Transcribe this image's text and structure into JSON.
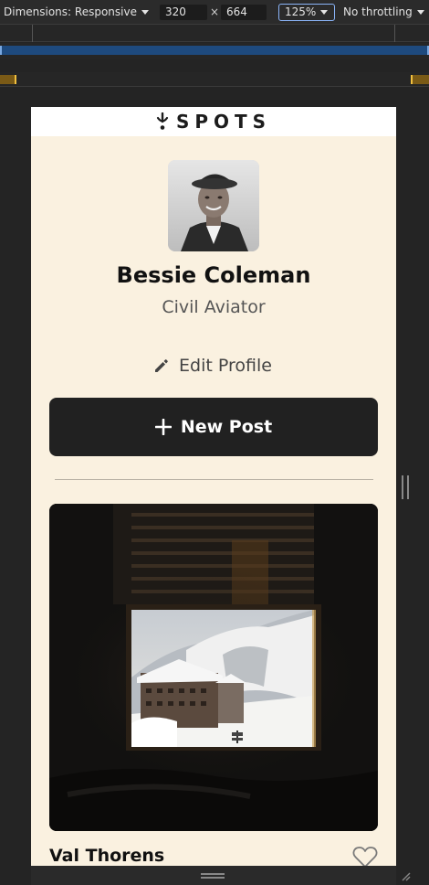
{
  "devtools": {
    "dimensions_label": "Dimensions: Responsive",
    "width_value": "320",
    "times": "×",
    "height_value": "664",
    "zoom": "125%",
    "throttling": "No throttling"
  },
  "app": {
    "logo_text": "SPOTS"
  },
  "profile": {
    "name": "Bessie Coleman",
    "description": "Civil Aviator",
    "edit_label": "Edit Profile",
    "new_post_label": "New Post"
  },
  "cards": [
    {
      "title": "Val Thorens",
      "liked": false
    }
  ],
  "colors": {
    "page_background": "#faf1e0",
    "button_dark": "#212121",
    "devtools_background": "#242424",
    "zoom_outline": "#8ab4f8"
  }
}
